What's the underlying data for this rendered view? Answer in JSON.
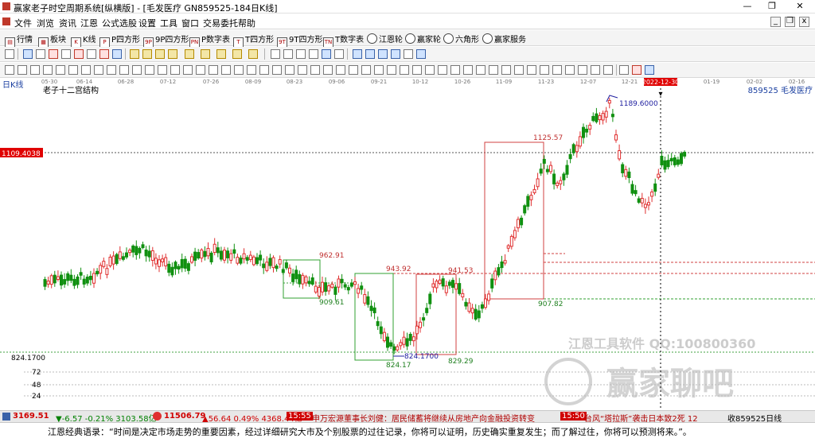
{
  "window": {
    "title": "赢家老子时空周期系统[纵横版] - [毛发医疗  GN859525-184日K线]"
  },
  "menu": [
    "文件",
    "浏览",
    "资讯",
    "江恩",
    "公式选股",
    "设置",
    "工具",
    "窗口",
    "交易委托",
    "帮助"
  ],
  "toolbar1": [
    "行情",
    "板块",
    "K线",
    "P四方形",
    "9P四方形",
    "P数字表",
    "T四方形",
    "9T四方形",
    "T数字表",
    "江恩轮",
    "赢家轮",
    "六角形",
    "赢家服务"
  ],
  "chart": {
    "period_label": "日K线",
    "study_name": "老子十二宫结构",
    "symbol_label": "859525  毛发医疗",
    "date_ticks": [
      "05-30",
      "06-14",
      "06-28",
      "07-12",
      "07-26",
      "08-09",
      "08-23",
      "09-06",
      "09-21",
      "10-12",
      "10-26",
      "11-09",
      "11-23",
      "12-07",
      "12-21",
      "2022-12-30",
      "01-19",
      "02-02",
      "02-16"
    ],
    "price_axis": {
      "current_price": "1109.4038",
      "low_price": "824.1700",
      "volume_ticks": [
        "72",
        "48",
        "24"
      ]
    },
    "annotations": {
      "high": "1189.6000",
      "low": "824.1700",
      "levels": [
        "962.91",
        "909.61",
        "943.92",
        "824.17",
        "941.53",
        "829.29",
        "1125.57",
        "907.82"
      ]
    },
    "watermark": {
      "line1": "江恩工具软件  QQ:100800360",
      "line2": "赢家聊吧"
    },
    "colors": {
      "up": "#e03030",
      "down": "#109010",
      "box_red": "#d04040",
      "box_green": "#30a030",
      "high_label": "#2020a0"
    }
  },
  "status": {
    "index1": "3169.51",
    "index1_change": "▼-6.57 -0.21% 3103.58亿",
    "index2": "11506.79",
    "index2_change": "▲56.64 0.49% 4368.44亿",
    "time1": "15:55",
    "news1": "申万宏源董事长刘健：居民储蓄将继续从房地产向金融投资转变",
    "time2": "15:50",
    "news2": "台风“塔拉斯”袭击日本致2死 12",
    "right": "收859525日线"
  },
  "quote": {
    "text": "江恩经典语录：“时间是决定市场走势的重要因素，经过详细研究大市及个别股票的过往记录，你将可以证明，历史确实重复发生；而了解过往，你将可以预测将来。”。"
  }
}
